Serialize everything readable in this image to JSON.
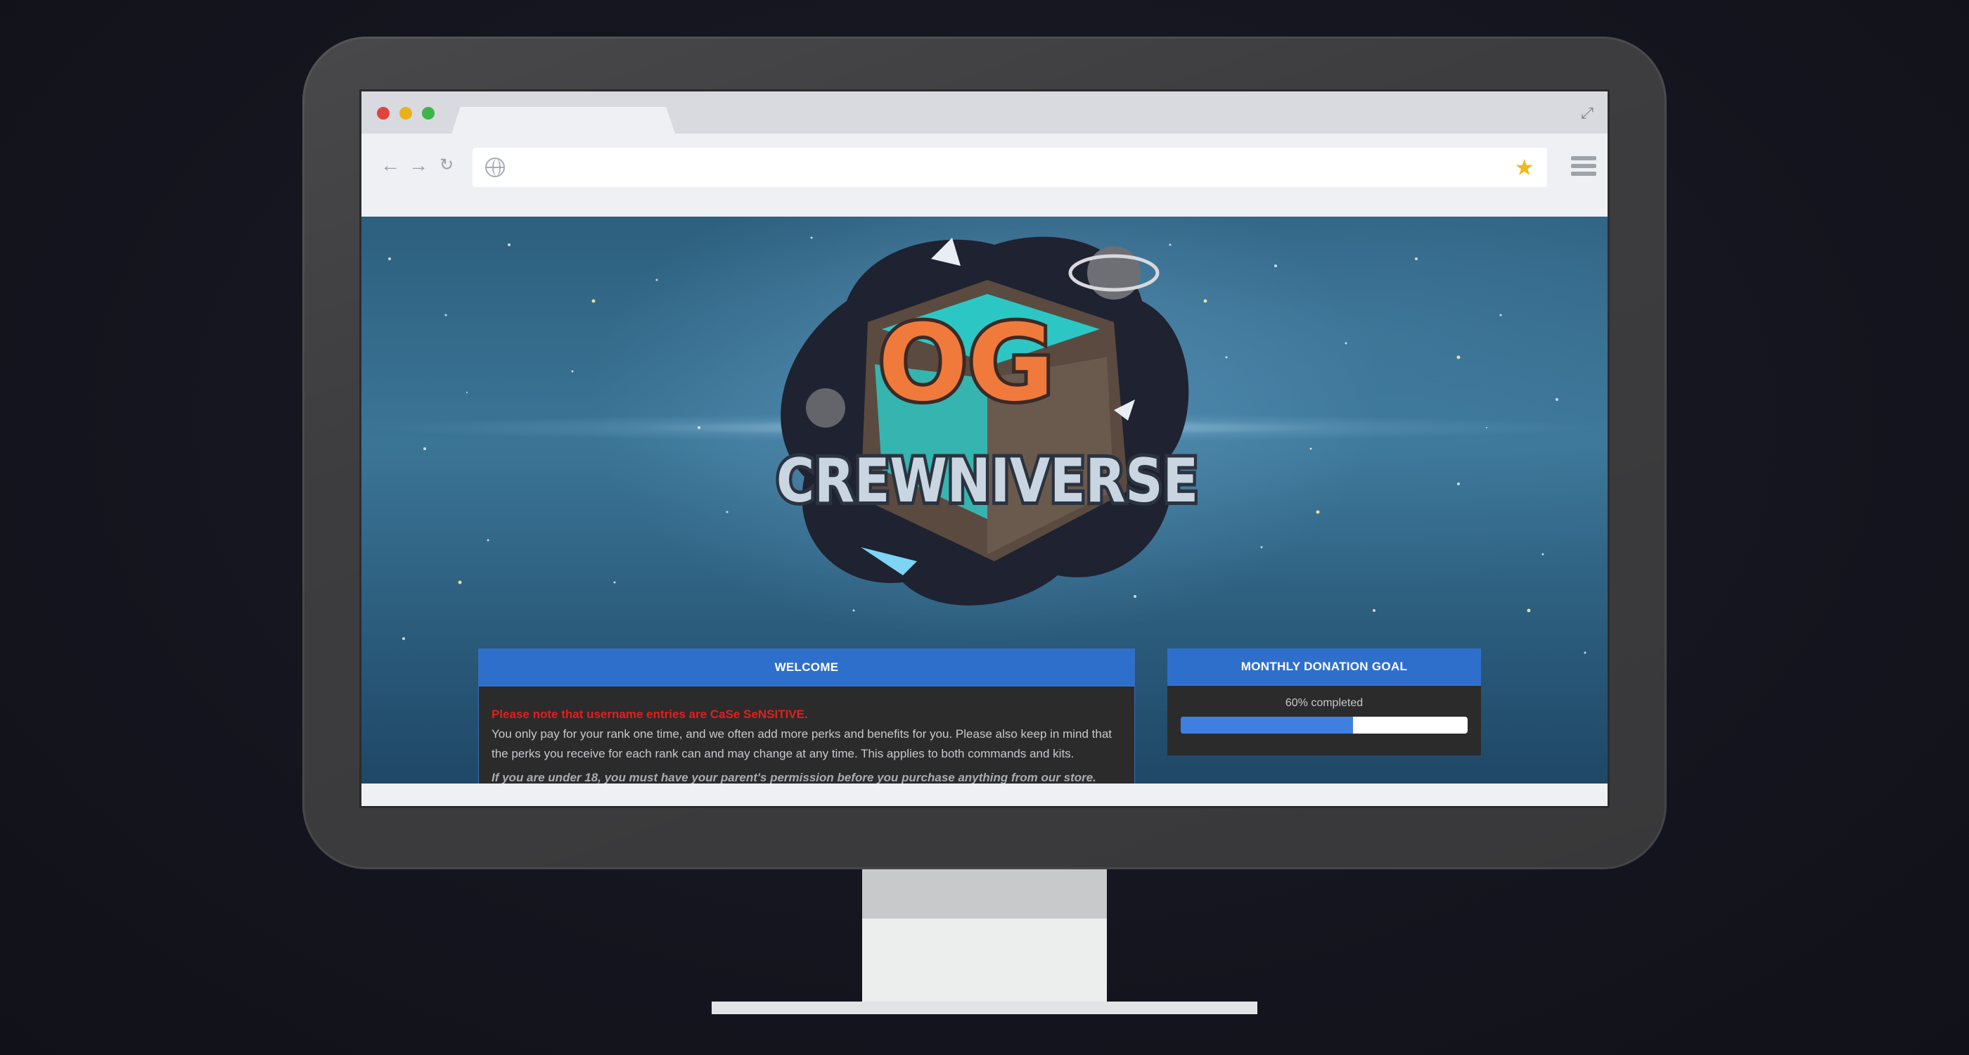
{
  "browser": {
    "tab_title": "",
    "url_placeholder": "",
    "url_value": ""
  },
  "icons": {
    "back": "arrow-left-icon",
    "forward": "arrow-right-icon",
    "reload": "reload-icon",
    "globe": "globe-icon",
    "bookmark": "star-icon",
    "menu": "hamburger-menu-icon",
    "expand": "expand-icon"
  },
  "hero": {
    "logo_line1": "OG",
    "logo_line2": "CREWNIVERSE"
  },
  "welcome": {
    "title": "WELCOME",
    "warning": "Please note that username entries are CaSe SeNSITIVE.",
    "body": "You only pay for your rank one time, and we often add more perks and benefits for you. Please also keep in mind that the perks you receive for each rank can and may change at any time. This applies to both commands and kits.",
    "disclaimer": "If you are under 18, you must have your parent's permission before you purchase anything from our store."
  },
  "donation": {
    "title": "MONTHLY DONATION GOAL",
    "progress_label": "60% completed",
    "progress_percent": 60
  },
  "colors": {
    "accent": "#2f6fcc",
    "warning": "#e41e1e",
    "progress": "#3f7fe0",
    "bookmark": "#f3b81a"
  }
}
